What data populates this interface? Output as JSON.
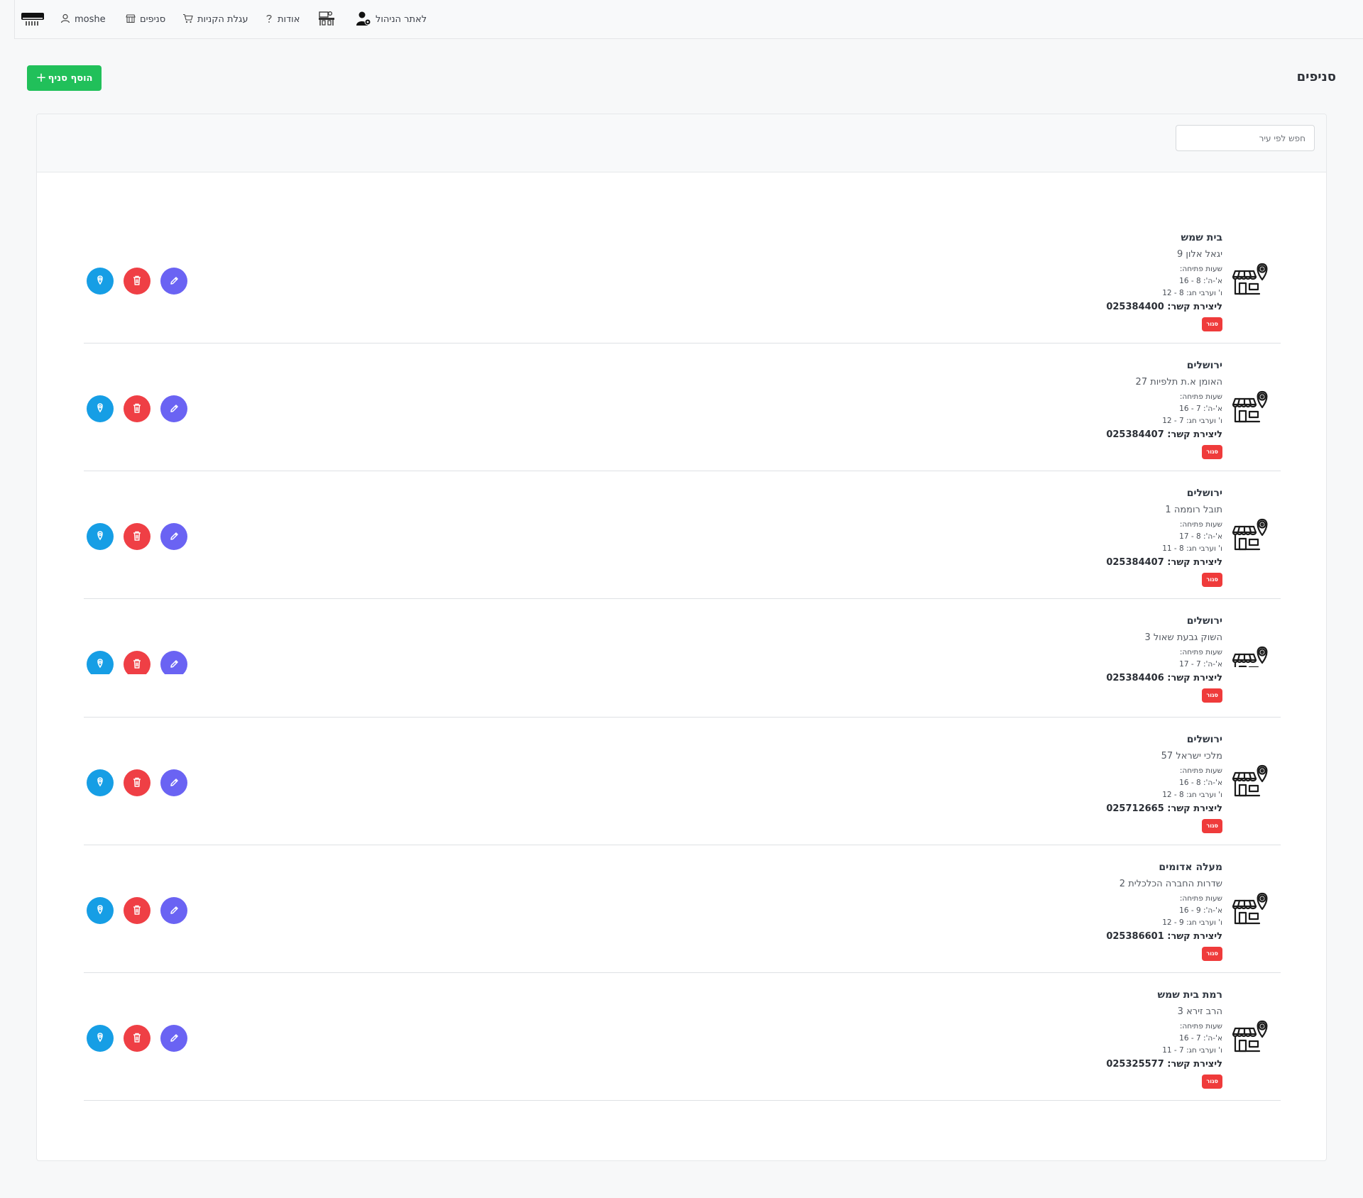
{
  "nav": {
    "user": "moshe",
    "branches": "סניפים",
    "cart": "עגלת הקניות",
    "about": "אודות",
    "admin": "לאתר הניהול"
  },
  "page": {
    "title": "סניפים",
    "add_button": "הוסף סניף",
    "search_placeholder": "חפש לפי עיר"
  },
  "colors": {
    "add": "#21c05a",
    "location": "#169ee5",
    "delete": "#ef3f45",
    "edit": "#6a63f3",
    "closed_badge": "#ef3b3b"
  },
  "branches": [
    {
      "city": "בית שמש",
      "address": "יגאל אלון 9",
      "hours_label": "שעות פתיחה:",
      "weekday": "א'-ה': 8 - 16",
      "friday": "ו' וערבי חג: 8 - 12",
      "contact": "ליצירת קשר: 025384400",
      "status": "סגור"
    },
    {
      "city": "ירושלים",
      "address": "האומן א.ת תלפיות 27",
      "hours_label": "שעות פתיחה:",
      "weekday": "א'-ה': 7 - 16",
      "friday": "ו' וערבי חג: 7 - 12",
      "contact": "ליצירת קשר: 025384407",
      "status": "סגור"
    },
    {
      "city": "ירושלים",
      "address": "תובל רוממה 1",
      "hours_label": "שעות פתיחה:",
      "weekday": "א'-ה': 8 - 17",
      "friday": "ו' וערבי חג: 8 - 11",
      "contact": "ליצירת קשר: 025384407",
      "status": "סגור"
    },
    {
      "city": "ירושלים",
      "address": "השוק גבעת שאול 3",
      "hours_label": "שעות פתיחה:",
      "weekday": "א'-ה': 7 - 17",
      "friday": "",
      "contact": "ליצירת קשר: 025384406",
      "status": "סגור"
    },
    {
      "city": "ירושלים",
      "address": "מלכי ישראל 57",
      "hours_label": "שעות פתיחה:",
      "weekday": "א'-ה': 8 - 16",
      "friday": "ו' וערבי חג: 8 - 12",
      "contact": "ליצירת קשר: 025712665",
      "status": "סגור"
    },
    {
      "city": "מעלה אדומים",
      "address": "שדרות החברה הכלכלית 2",
      "hours_label": "שעות פתיחה:",
      "weekday": "א'-ה': 9 - 16",
      "friday": "ו' וערבי חג: 9 - 12",
      "contact": "ליצירת קשר: 025386601",
      "status": "סגור"
    },
    {
      "city": "רמת בית שמש",
      "address": "הרב זירא 3",
      "hours_label": "שעות פתיחה:",
      "weekday": "א'-ה': 7 - 16",
      "friday": "ו' וערבי חג: 7 - 11",
      "contact": "ליצירת קשר: 025325577",
      "status": "סגור"
    }
  ]
}
